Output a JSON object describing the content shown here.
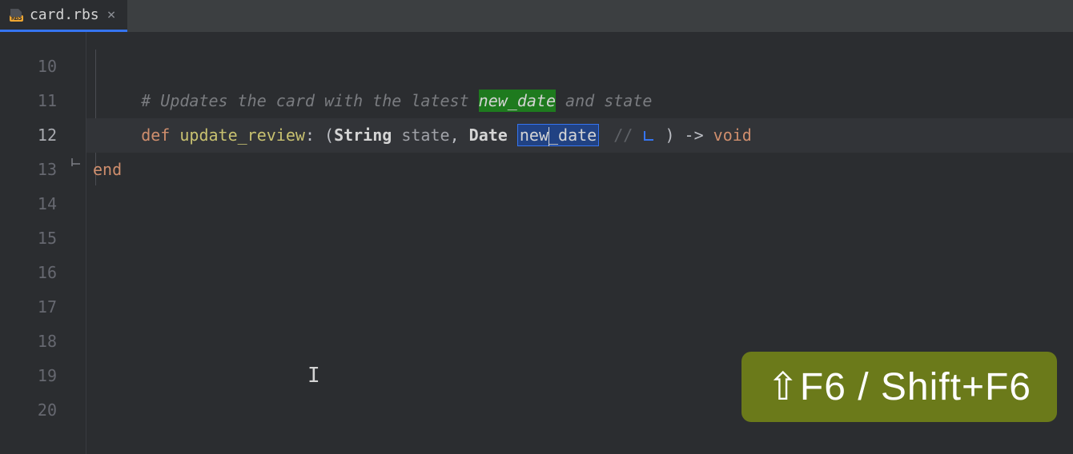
{
  "tab": {
    "icon_badge": "RBS",
    "filename": "card.rbs",
    "close_glyph": "×"
  },
  "gutter": {
    "start": 10,
    "end": 20,
    "active": 12
  },
  "code": {
    "comment_prefix": "# Updates the card with the latest ",
    "comment_highlight": "new_date",
    "comment_suffix": " and state",
    "def_kw": "def",
    "method_name": "update_review",
    "colon_open": ": (",
    "type1": "String",
    "param1": " state",
    "comma": ", ",
    "type2": "Date",
    "space": " ",
    "rename_pre": "new",
    "rename_post": "_date",
    "hint_slashes": "//",
    "close_arrow": " ) -> ",
    "void_kw": "void",
    "end_kw": "end"
  },
  "overlay": {
    "text_cursor": "I",
    "shortcut": "⇧F6 / Shift+F6"
  }
}
